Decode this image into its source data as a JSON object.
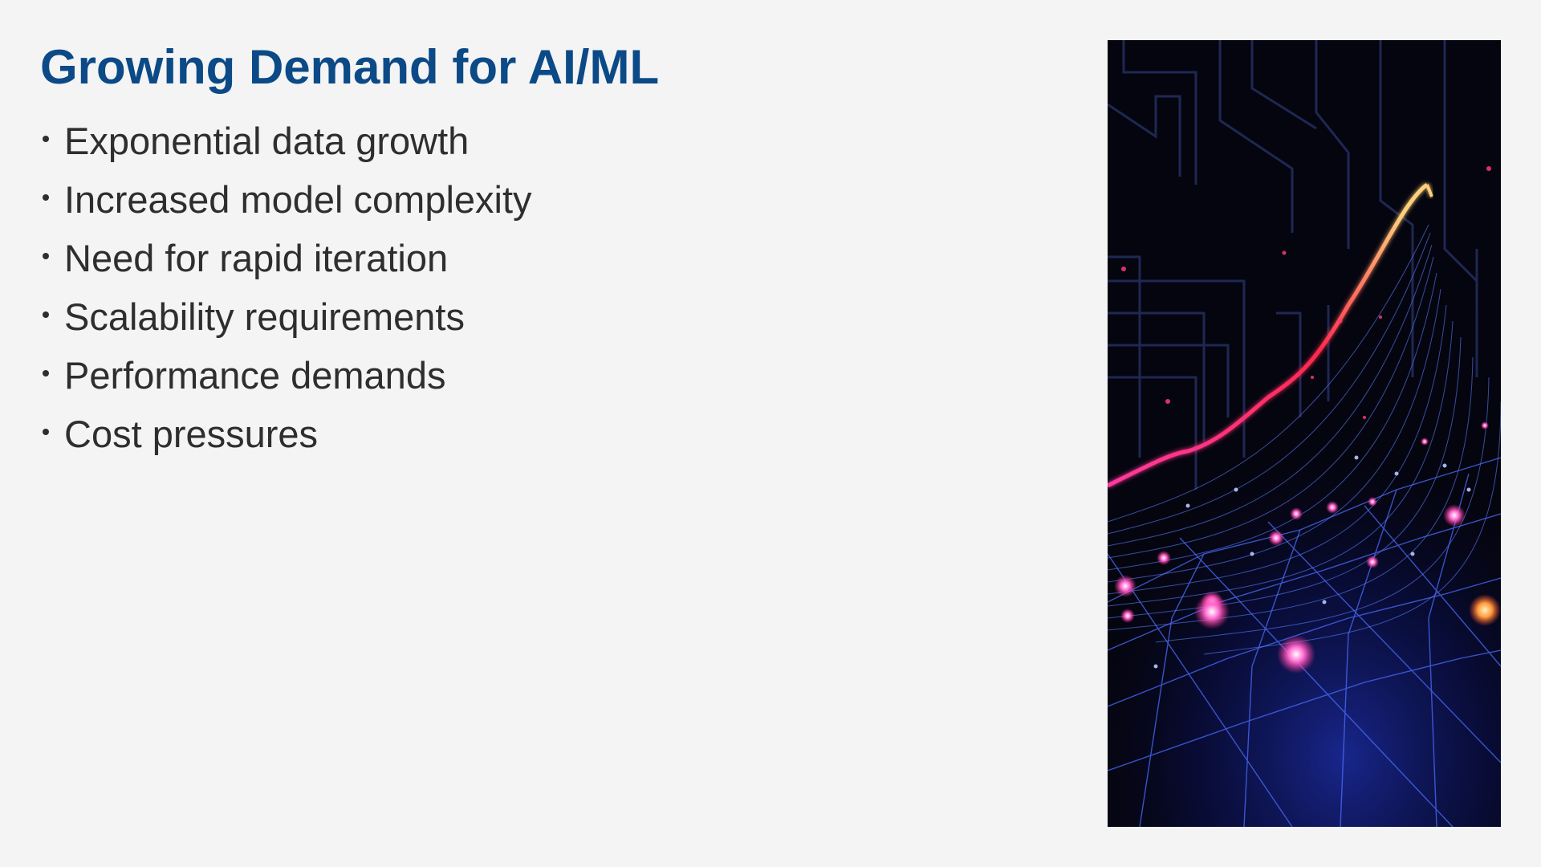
{
  "slide": {
    "title": "Growing Demand for AI/ML",
    "bullets": [
      "Exponential data growth",
      "Increased model complexity",
      "Need for rapid iteration",
      "Scalability requirements",
      "Performance demands",
      "Cost pressures"
    ]
  },
  "image": {
    "icon": "exponential-growth-network-illustration"
  },
  "colors": {
    "background": "#f4f4f4",
    "title": "#0b4a86",
    "body_text": "#2e2e2e",
    "image_bg": "#05050f",
    "glow_red": "#ff2a4d",
    "glow_blue": "#3a6bff",
    "glow_pink": "#ff4fb0"
  }
}
